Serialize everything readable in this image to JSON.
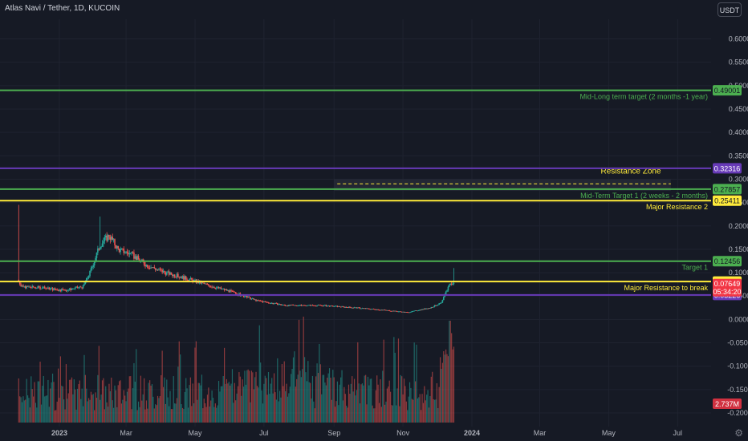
{
  "header": {
    "title": "Atlas Navi / Tether, 1D, KUCOIN",
    "currency": "USDT"
  },
  "colors": {
    "background": "#161a25",
    "text": "#b2b5be",
    "grid": "#1f2330",
    "up": "#26a69a",
    "down": "#ef5350",
    "green_line": "#4caf50",
    "yellow_line": "#ffeb3b",
    "purple_line": "#673ab7",
    "last_price": "#f23645"
  },
  "chart_data": {
    "type": "candlestick",
    "y_axis": {
      "min": -0.2,
      "max": 0.63,
      "ticks": [
        0.6,
        0.55,
        0.5,
        0.45,
        0.4,
        0.35,
        0.3,
        0.25,
        0.2,
        0.15,
        0.1,
        0.05,
        0.0,
        -0.05,
        -0.1,
        -0.15,
        -0.2
      ],
      "tick_labels": [
        "0.60000",
        "0.55000",
        "0.50000",
        "0.45000",
        "0.40000",
        "0.35000",
        "0.30000",
        "0.25000",
        "0.20000",
        "0.15000",
        "0.10000",
        "0.05000",
        "0.00000",
        "-0.05000",
        "-0.10000",
        "-0.15000",
        "-0.20000"
      ]
    },
    "x_axis": {
      "start": "2022-11-15",
      "end": "2024-07-25",
      "tick_labels": [
        {
          "date": "2023-01-01",
          "label": "2023"
        },
        {
          "date": "2023-03-01",
          "label": "Mar"
        },
        {
          "date": "2023-05-01",
          "label": "May"
        },
        {
          "date": "2023-07-01",
          "label": "Jul"
        },
        {
          "date": "2023-09-01",
          "label": "Sep"
        },
        {
          "date": "2023-11-01",
          "label": "Nov"
        },
        {
          "date": "2024-01-01",
          "label": "2024"
        },
        {
          "date": "2024-03-01",
          "label": "Mar"
        },
        {
          "date": "2024-05-01",
          "label": "May"
        },
        {
          "date": "2024-07-01",
          "label": "Jul"
        }
      ]
    },
    "price_keypoints": [
      {
        "date": "2022-11-26",
        "price": 0.085,
        "high": 0.245
      },
      {
        "date": "2022-11-28",
        "price": 0.07
      },
      {
        "date": "2022-12-15",
        "price": 0.068
      },
      {
        "date": "2023-01-05",
        "price": 0.062
      },
      {
        "date": "2023-01-22",
        "price": 0.07
      },
      {
        "date": "2023-01-28",
        "price": 0.1
      },
      {
        "date": "2023-02-06",
        "price": 0.16,
        "high": 0.22
      },
      {
        "date": "2023-02-14",
        "price": 0.18
      },
      {
        "date": "2023-02-22",
        "price": 0.15
      },
      {
        "date": "2023-03-05",
        "price": 0.14
      },
      {
        "date": "2023-03-20",
        "price": 0.115
      },
      {
        "date": "2023-04-05",
        "price": 0.1
      },
      {
        "date": "2023-04-20",
        "price": 0.09
      },
      {
        "date": "2023-05-10",
        "price": 0.075
      },
      {
        "date": "2023-06-01",
        "price": 0.06
      },
      {
        "date": "2023-06-25",
        "price": 0.04
      },
      {
        "date": "2023-07-20",
        "price": 0.03
      },
      {
        "date": "2023-08-20",
        "price": 0.03
      },
      {
        "date": "2023-09-20",
        "price": 0.025
      },
      {
        "date": "2023-10-15",
        "price": 0.02
      },
      {
        "date": "2023-11-05",
        "price": 0.015
      },
      {
        "date": "2023-11-25",
        "price": 0.025
      },
      {
        "date": "2023-12-05",
        "price": 0.035
      },
      {
        "date": "2023-12-12",
        "price": 0.075
      },
      {
        "date": "2023-12-16",
        "price": 0.0765,
        "high": 0.11
      }
    ],
    "volume_axis": {
      "max": 2.737,
      "label": "2.737M"
    },
    "levels": [
      {
        "name": "mid-long-term-target",
        "value": 0.49001,
        "label": "0.49001",
        "color": "#4caf50",
        "text": "Mid-Long term target (2 months -1 year)",
        "text_color": "#4caf50"
      },
      {
        "name": "resistance-zone-top",
        "value": 0.32316,
        "label": "0.32316",
        "color": "#673ab7",
        "text": "",
        "text_color": ""
      },
      {
        "name": "mid-term-target-1",
        "value": 0.27857,
        "label": "0.27857",
        "color": "#4caf50",
        "text": "Mid-Term Target 1 (2 weeks - 2 months)",
        "text_color": "#4caf50"
      },
      {
        "name": "major-resistance-2",
        "value": 0.25411,
        "label": "0.25411",
        "color": "#ffeb3b",
        "text": "Major Resistance 2",
        "text_color": "#ffeb3b"
      },
      {
        "name": "target-1",
        "value": 0.12456,
        "label": "0.12456",
        "color": "#4caf50",
        "text": "Target 1",
        "text_color": "#4caf50"
      },
      {
        "name": "major-resistance-to-break",
        "value": 0.08106,
        "label": "0.08106",
        "color": "#ffeb3b",
        "text": "Major Resistance to break",
        "text_color": "#ffeb3b"
      },
      {
        "name": "support",
        "value": 0.05226,
        "label": "0.05226",
        "color": "#673ab7",
        "text": "",
        "text_color": ""
      }
    ],
    "last_price": {
      "value": 0.07649,
      "label": "0.07649",
      "countdown": "05:34:20"
    },
    "zone": {
      "label": "Resistance Zone",
      "start": "2023-09-01",
      "end": "2024-06-25",
      "top": 0.3,
      "bottom": 0.275,
      "mid": 0.29
    }
  }
}
